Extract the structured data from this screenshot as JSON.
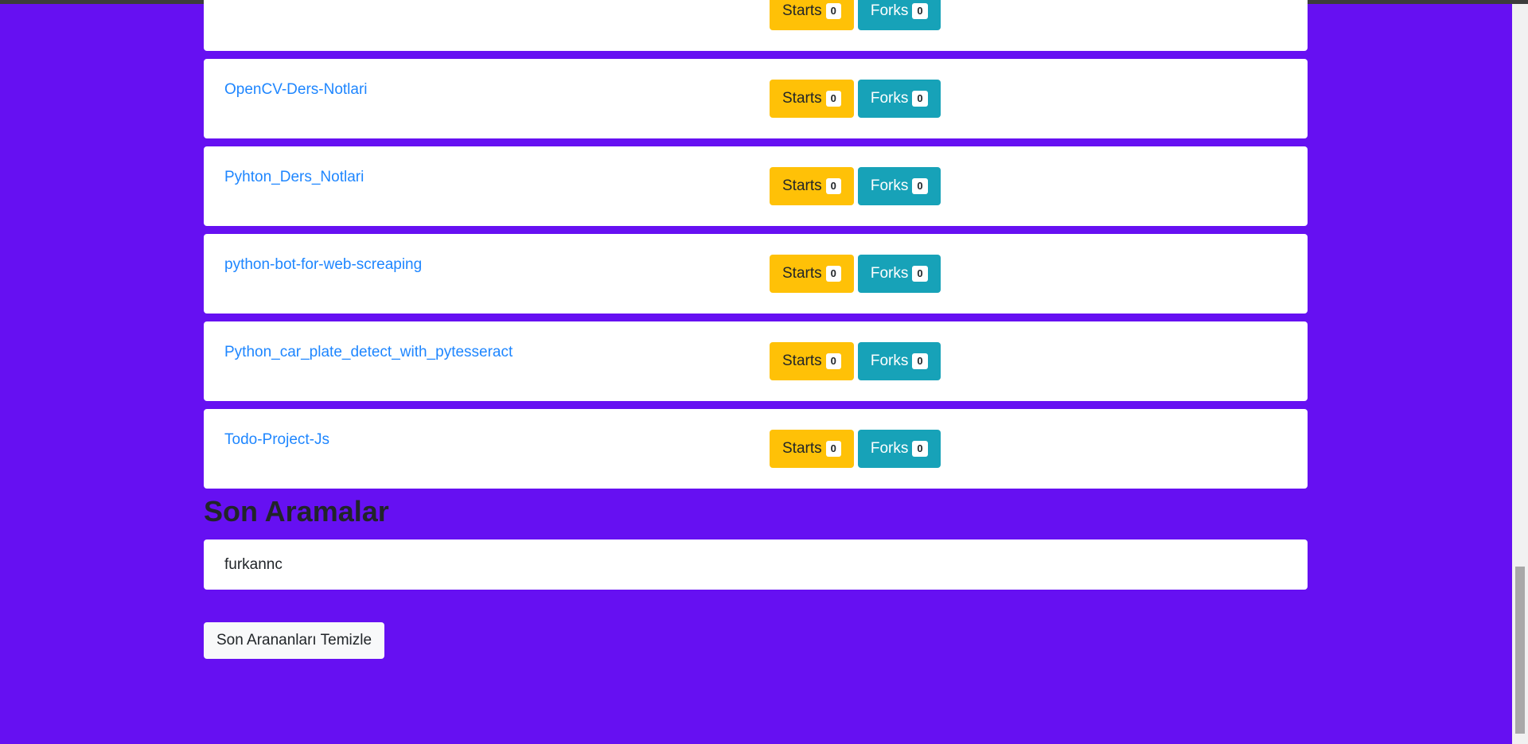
{
  "repos": [
    {
      "name": "",
      "stars_label": "Starts",
      "stars": "0",
      "forks_label": "Forks",
      "forks": "0"
    },
    {
      "name": "OpenCV-Ders-Notlari",
      "stars_label": "Starts",
      "stars": "0",
      "forks_label": "Forks",
      "forks": "0"
    },
    {
      "name": "Pyhton_Ders_Notlari",
      "stars_label": "Starts",
      "stars": "0",
      "forks_label": "Forks",
      "forks": "0"
    },
    {
      "name": "python-bot-for-web-screaping",
      "stars_label": "Starts",
      "stars": "0",
      "forks_label": "Forks",
      "forks": "0"
    },
    {
      "name": "Python_car_plate_detect_with_pytesseract",
      "stars_label": "Starts",
      "stars": "0",
      "forks_label": "Forks",
      "forks": "0"
    },
    {
      "name": "Todo-Project-Js",
      "stars_label": "Starts",
      "stars": "0",
      "forks_label": "Forks",
      "forks": "0"
    }
  ],
  "recent": {
    "title": "Son Aramalar",
    "items": [
      "furkannc"
    ],
    "clear_label": "Son Arananları Temizle"
  },
  "colors": {
    "background": "#6610f2",
    "link": "#1e86ff",
    "stars_button": "#ffc107",
    "forks_button": "#17a2b8"
  }
}
